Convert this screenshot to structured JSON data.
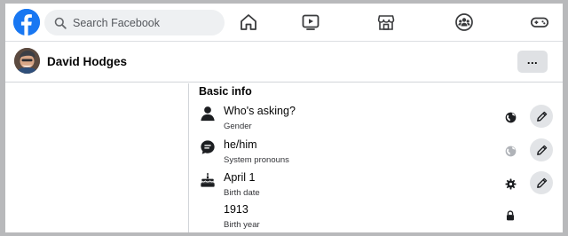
{
  "search": {
    "placeholder": "Search Facebook"
  },
  "nav": {
    "items": [
      {
        "icon": "home-icon"
      },
      {
        "icon": "watch-icon"
      },
      {
        "icon": "marketplace-icon"
      },
      {
        "icon": "groups-icon"
      },
      {
        "icon": "gaming-icon"
      }
    ]
  },
  "profile": {
    "name": "David Hodges",
    "more_label": "..."
  },
  "basic_info": {
    "title": "Basic info",
    "rows": [
      {
        "value": "Who's asking?",
        "label": "Gender",
        "icon": "person-icon",
        "audience": "public-icon",
        "editable": true
      },
      {
        "value": "he/him",
        "label": "System pronouns",
        "icon": "chat-bubble-icon",
        "audience": "public-icon-dim",
        "editable": true
      },
      {
        "value": "April 1",
        "label": "Birth date",
        "icon": "cake-icon",
        "audience": "gear-icon",
        "editable": true
      },
      {
        "value": "1913",
        "label": "Birth year",
        "icon": "",
        "audience": "lock-icon",
        "editable": false
      }
    ]
  },
  "colors": {
    "brand": "#1877f2",
    "background": "#b8b9bb",
    "button": "#e2e4e7"
  }
}
